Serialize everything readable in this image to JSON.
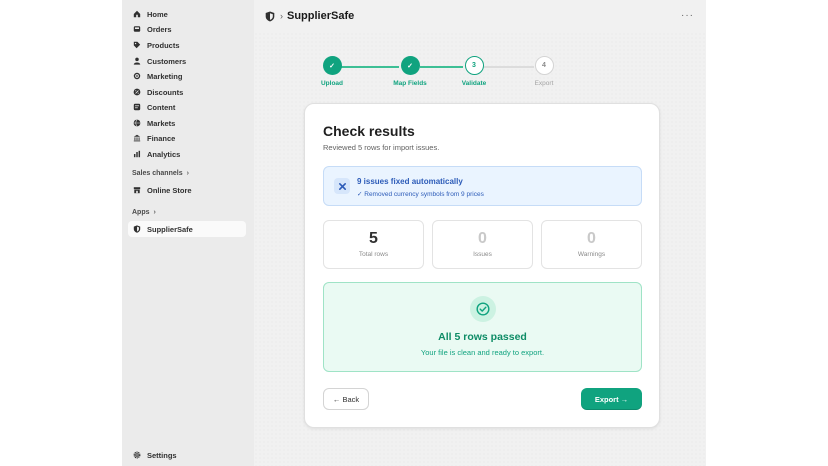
{
  "sidebar": {
    "items": [
      {
        "label": "Home",
        "icon": "home-icon"
      },
      {
        "label": "Orders",
        "icon": "inbox-icon"
      },
      {
        "label": "Products",
        "icon": "tag-icon"
      },
      {
        "label": "Customers",
        "icon": "person-icon"
      },
      {
        "label": "Marketing",
        "icon": "target-icon"
      },
      {
        "label": "Discounts",
        "icon": "discount-icon"
      },
      {
        "label": "Content",
        "icon": "content-icon"
      },
      {
        "label": "Markets",
        "icon": "globe-icon"
      },
      {
        "label": "Finance",
        "icon": "bank-icon"
      },
      {
        "label": "Analytics",
        "icon": "chart-bar-icon"
      }
    ],
    "sales_channels_label": "Sales channels",
    "online_store_label": "Online Store",
    "apps_label": "Apps",
    "app_item_label": "SupplierSafe",
    "settings_label": "Settings"
  },
  "header": {
    "app_title": "SupplierSafe",
    "more_label": "···"
  },
  "stepper": {
    "steps": [
      {
        "label": "Upload",
        "marker": "✓",
        "state": "done"
      },
      {
        "label": "Map Fields",
        "marker": "✓",
        "state": "done"
      },
      {
        "label": "Validate",
        "marker": "3",
        "state": "current"
      },
      {
        "label": "Export",
        "marker": "4",
        "state": "todo"
      }
    ]
  },
  "card": {
    "title": "Check results",
    "subtitle": "Reviewed 5 rows for import issues.",
    "notice": {
      "title": "9 issues fixed automatically",
      "detail": "✓ Removed currency symbols from 9 prices"
    },
    "stats": [
      {
        "value": "5",
        "label": "Total rows"
      },
      {
        "value": "0",
        "label": "Issues"
      },
      {
        "value": "0",
        "label": "Warnings"
      }
    ],
    "success": {
      "title": "All 5 rows passed",
      "message": "Your file is clean and ready to export."
    },
    "back_label": "← Back",
    "export_label": "Export →"
  },
  "colors": {
    "accent": "#10a37f",
    "info": "#2c5bb8",
    "success_bg": "#eafaf3"
  }
}
